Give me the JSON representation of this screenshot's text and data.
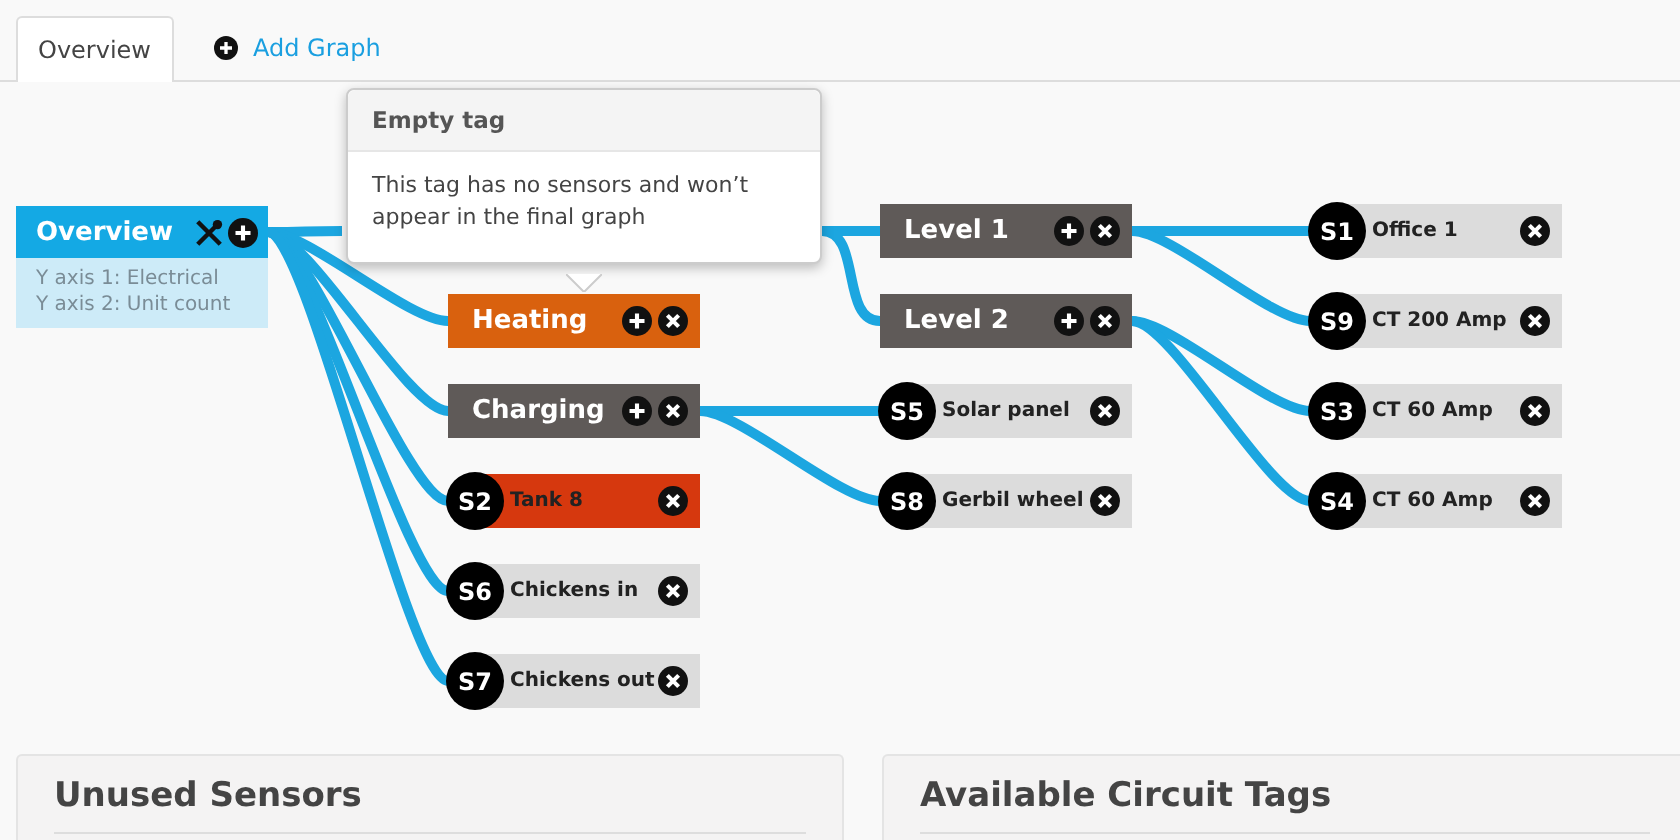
{
  "tabs": [
    {
      "label": "Overview",
      "selected": true,
      "kind": "tab"
    },
    {
      "label": "Add Graph",
      "selected": false,
      "kind": "add"
    }
  ],
  "graph": {
    "root": {
      "label": "Overview",
      "info": [
        "Y axis 1: Electrical",
        "Y axis 2: Unit count"
      ],
      "children": [
        {
          "kind": "covered",
          "children": [
            {
              "kind": "tag",
              "label": "Level 1",
              "color": "#5f5a58",
              "children": [
                {
                  "kind": "sensor",
                  "badge": "S1",
                  "label": "Office 1",
                  "color": "#dcdcdc"
                },
                {
                  "kind": "sensor",
                  "badge": "S9",
                  "label": "CT 200 Amp",
                  "color": "#dcdcdc"
                }
              ]
            },
            {
              "kind": "tag",
              "label": "Level 2",
              "color": "#5f5a58",
              "children": [
                {
                  "kind": "sensor",
                  "badge": "S3",
                  "label": "CT 60 Amp",
                  "color": "#dcdcdc"
                },
                {
                  "kind": "sensor",
                  "badge": "S4",
                  "label": "CT 60 Amp",
                  "color": "#dcdcdc"
                }
              ]
            }
          ]
        },
        {
          "kind": "tag",
          "label": "Heating",
          "color": "#d9610e"
        },
        {
          "kind": "tag",
          "label": "Charging",
          "color": "#5f5a58",
          "children": [
            {
              "kind": "sensor",
              "badge": "S5",
              "label": "Solar panel",
              "color": "#dcdcdc"
            },
            {
              "kind": "sensor",
              "badge": "S8",
              "label": "Gerbil wheel",
              "color": "#dcdcdc"
            }
          ]
        },
        {
          "kind": "sensor",
          "badge": "S2",
          "label": "Tank 8",
          "color": "#d6380e"
        },
        {
          "kind": "sensor",
          "badge": "S6",
          "label": "Chickens in",
          "color": "#dcdcdc"
        },
        {
          "kind": "sensor",
          "badge": "S7",
          "label": "Chickens out",
          "color": "#dcdcdc"
        }
      ]
    }
  },
  "tooltip": {
    "title": "Empty tag",
    "text": "This tag has no sensors and won’t appear in the final graph"
  },
  "panels": [
    {
      "title": "Unused Sensors"
    },
    {
      "title": "Available Circuit Tags"
    }
  ]
}
